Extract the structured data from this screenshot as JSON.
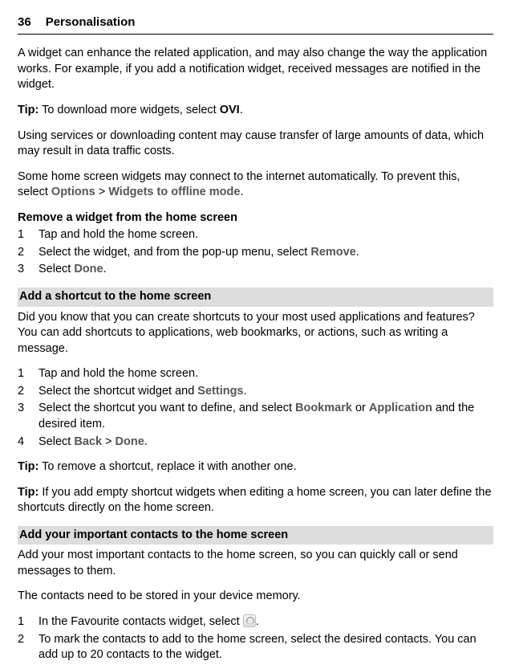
{
  "header": {
    "page_number": "36",
    "title": "Personalisation"
  },
  "intro_paragraph": "A widget can enhance the related application, and may also change the way the application works. For example, if you add a notification widget, received messages are notified in the widget.",
  "tip1": {
    "label": "Tip:",
    "before": " To download more widgets, select ",
    "bold": "OVI",
    "after": "."
  },
  "data_costs": "Using services or downloading content may cause transfer of large amounts of data, which may result in data traffic costs.",
  "auto_connect": {
    "before": "Some home screen widgets may connect to the internet automatically. To prevent this, select ",
    "options": "Options",
    "sep": "  > ",
    "widgets_offline": "Widgets to offline mode",
    "after": "."
  },
  "remove_widget": {
    "heading": "Remove a widget from the home screen",
    "steps": {
      "s1": "Tap and hold the home screen.",
      "s2_before": "Select the widget, and from the pop-up menu, select ",
      "s2_bold": "Remove",
      "s2_after": ".",
      "s3_before": "Select ",
      "s3_bold": "Done",
      "s3_after": "."
    }
  },
  "add_shortcut": {
    "heading": "Add a shortcut to the home screen",
    "intro": "Did you know that you can create shortcuts to your most used applications and features? You can add shortcuts to applications, web bookmarks, or actions, such as writing a message.",
    "steps": {
      "s1": "Tap and hold the home screen.",
      "s2_before": "Select the shortcut widget and ",
      "s2_bold": "Settings",
      "s2_after": ".",
      "s3_before": "Select the shortcut you want to define, and select ",
      "s3_b1": "Bookmark",
      "s3_or": " or ",
      "s3_b2": "Application",
      "s3_after": " and the desired item.",
      "s4_before": "Select ",
      "s4_b1": "Back",
      "s4_sep": "  > ",
      "s4_b2": "Done",
      "s4_after": "."
    },
    "tip_remove": {
      "label": "Tip:",
      "text": " To remove a shortcut, replace it with another one."
    },
    "tip_empty": {
      "label": "Tip:",
      "text": " If you add empty shortcut widgets when editing a home screen, you can later define the shortcuts directly on the home screen."
    }
  },
  "add_contacts": {
    "heading": "Add your important contacts to the home screen",
    "intro": "Add your most important contacts to the home screen, so you can quickly call or send messages to them.",
    "memory_note": "The contacts need to be stored in your device memory.",
    "steps": {
      "s1_before": "In the Favourite contacts widget, select ",
      "s1_after": ".",
      "s2": "To mark the contacts to add to the home screen, select the desired contacts. You can add up to 20 contacts to the widget."
    }
  }
}
